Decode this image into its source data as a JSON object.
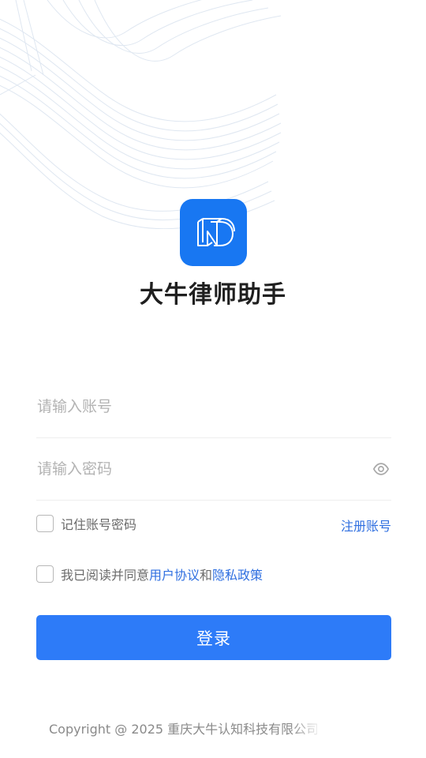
{
  "app": {
    "title": "大牛律师助手",
    "logo_icon": "nd-logo-icon",
    "brand_color": "#1877f2"
  },
  "form": {
    "account_placeholder": "请输入账号",
    "account_value": "",
    "password_placeholder": "请输入密码",
    "password_value": "",
    "password_toggle_icon": "eye-icon",
    "remember_label": "记住账号密码",
    "remember_checked": false,
    "register_link": "注册账号",
    "agree_prefix": "我已阅读并同意",
    "user_agreement_link": "用户协议",
    "agree_and": "和",
    "privacy_policy_link": "隐私政策",
    "agree_checked": false,
    "login_button": "登录",
    "accent_color": "#2d7bf8",
    "link_color": "#2f6fe0"
  },
  "footer": {
    "copyright": "Copyright @ 2025 重庆大牛认知科技有限公司"
  }
}
